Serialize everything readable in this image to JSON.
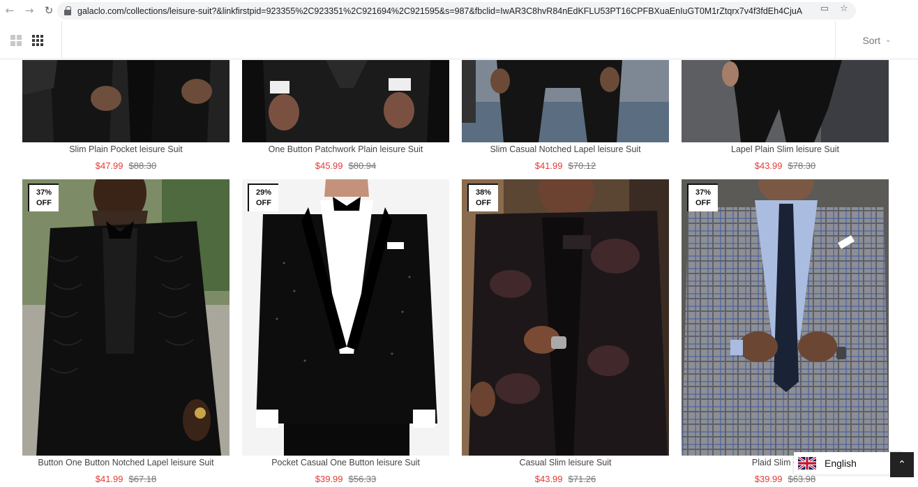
{
  "browser": {
    "url": "galaclo.com/collections/leisure-suit?&linkfirstpid=923355%2C923351%2C921694%2C921595&s=987&fbclid=IwAR3C8hvR84nEdKFLU53PT16CPFBXuaEnIuGT0M1rZtqrx7v4f3fdEh4CjuA",
    "back_icon": "back-arrow-icon",
    "forward_icon": "forward-arrow-icon",
    "reload_icon": "reload-icon"
  },
  "toolbar": {
    "sort_label": "Sort",
    "grid_options": [
      "grid-2-icon",
      "grid-3-icon"
    ]
  },
  "products_row1": [
    {
      "title": "Slim Plain Pocket leisure Suit",
      "price": "$47.99",
      "compare_price": "$88.30"
    },
    {
      "title": "One Button Patchwork Plain leisure Suit",
      "price": "$45.99",
      "compare_price": "$80.94"
    },
    {
      "title": "Slim Casual Notched Lapel leisure Suit",
      "price": "$41.99",
      "compare_price": "$70.12"
    },
    {
      "title": "Lapel Plain Slim leisure Suit",
      "price": "$43.99",
      "compare_price": "$78.30"
    }
  ],
  "products_row2": [
    {
      "title": "Button One Button Notched Lapel leisure Suit",
      "price": "$41.99",
      "compare_price": "$67.18",
      "badge_pct": "37%",
      "badge_off": "OFF"
    },
    {
      "title": "Pocket Casual One Button leisure Suit",
      "price": "$39.99",
      "compare_price": "$56.33",
      "badge_pct": "29%",
      "badge_off": "OFF"
    },
    {
      "title": "Casual Slim leisure Suit",
      "price": "$43.99",
      "compare_price": "$71.26",
      "badge_pct": "38%",
      "badge_off": "OFF"
    },
    {
      "title": "Plaid Slim Casua",
      "price": "$39.99",
      "compare_price": "$63.98",
      "badge_pct": "37%",
      "badge_off": "OFF"
    }
  ],
  "language": {
    "label": "English",
    "flag_icon": "uk-flag-icon"
  },
  "colors": {
    "price": "#e53935",
    "accent": "#111111"
  }
}
